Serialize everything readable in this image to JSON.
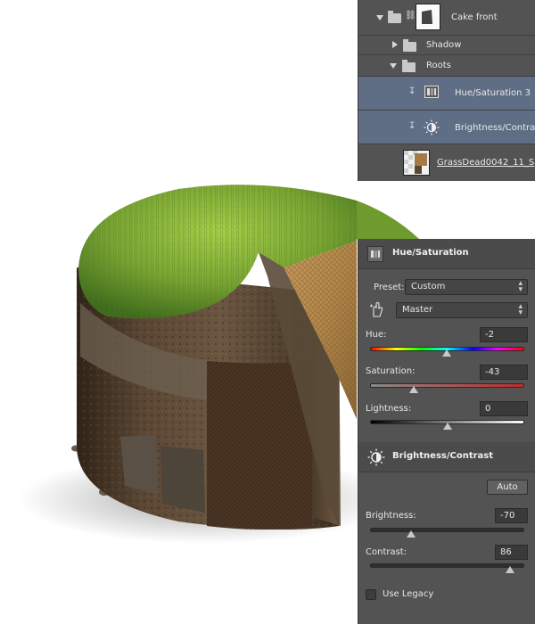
{
  "layers_panel": {
    "rows": [
      {
        "label": "Cake front",
        "expanded": true,
        "type": "group-with-mask"
      },
      {
        "label": "Shadow",
        "expanded": false,
        "type": "group"
      },
      {
        "label": "Roots",
        "expanded": true,
        "type": "group"
      },
      {
        "label": "Hue/Saturation 3",
        "type": "adjustment",
        "icon": "hue-saturation-icon",
        "selected": true,
        "clipped": true
      },
      {
        "label": "Brightness/Contrast",
        "type": "adjustment",
        "icon": "brightness-contrast-icon",
        "selected": true,
        "clipped": true
      },
      {
        "label": "GrassDead0042_11_S",
        "type": "pixel-layer",
        "selected": false
      }
    ],
    "selected_color": "#5f6e84"
  },
  "properties_panel": {
    "hue_saturation": {
      "title": "Hue/Saturation",
      "preset_label": "Preset:",
      "preset_value": "Custom",
      "channel_value": "Master",
      "hue_label": "Hue:",
      "hue_value": "-2",
      "saturation_label": "Saturation:",
      "saturation_value": "-43",
      "lightness_label": "Lightness:",
      "lightness_value": "0",
      "ranges": {
        "hue": [
          -180,
          180
        ],
        "saturation": [
          -100,
          100
        ],
        "lightness": [
          -100,
          100
        ]
      }
    },
    "brightness_contrast": {
      "title": "Brightness/Contrast",
      "auto_label": "Auto",
      "brightness_label": "Brightness:",
      "brightness_value": "-70",
      "contrast_label": "Contrast:",
      "contrast_value": "86",
      "use_legacy_label": "Use Legacy",
      "use_legacy_checked": false,
      "ranges": {
        "brightness": [
          -150,
          150
        ],
        "contrast": [
          -50,
          100
        ]
      }
    }
  },
  "colors": {
    "panel_bg": "#535353",
    "grass": "#6a9a2e",
    "soil": "#5a4633"
  }
}
